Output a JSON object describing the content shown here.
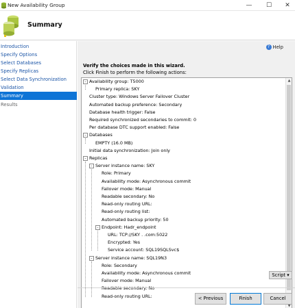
{
  "window": {
    "title": "New Availability Group",
    "minimize": "—",
    "maximize": "☐",
    "close": "✕"
  },
  "header": {
    "title": "Summary"
  },
  "sidebar": {
    "items": [
      {
        "label": "Introduction",
        "state": "link"
      },
      {
        "label": "Specify Options",
        "state": "link"
      },
      {
        "label": "Select Databases",
        "state": "link"
      },
      {
        "label": "Specify Replicas",
        "state": "link"
      },
      {
        "label": "Select Data Synchronization",
        "state": "link"
      },
      {
        "label": "Validation",
        "state": "link"
      },
      {
        "label": "Summary",
        "state": "selected"
      },
      {
        "label": "Results",
        "state": "disabled"
      }
    ]
  },
  "main": {
    "help_label": "Help",
    "verify_text": "Verify the choices made in this wizard.",
    "instruction": "Click Finish to perform the following actions:",
    "tree": [
      {
        "level": 0,
        "toggle": "-",
        "text": "Availability group: T5000"
      },
      {
        "level": 1,
        "text": "Primary replica: SKY"
      },
      {
        "level": 0,
        "text": "Cluster type: Windows Server Failover Cluster"
      },
      {
        "level": 0,
        "text": "Automated backup preference: Secondary"
      },
      {
        "level": 0,
        "text": "Database health trigger: False"
      },
      {
        "level": 0,
        "text": "Required synchronized secondaries to commit: 0"
      },
      {
        "level": 0,
        "text": "Per database DTC support enabled: False"
      },
      {
        "level": 0,
        "toggle": "-",
        "text": "Databases"
      },
      {
        "level": 1,
        "text": "EMPTY (16.0 MB)"
      },
      {
        "level": 0,
        "text": "Initial data synchronization: Join only"
      },
      {
        "level": 0,
        "toggle": "-",
        "text": "Replicas"
      },
      {
        "level": 1,
        "toggle": "-",
        "text": "Server instance name: SKY"
      },
      {
        "level": 2,
        "text": "Role: Primary"
      },
      {
        "level": 2,
        "text": "Availability mode: Asynchronous commit"
      },
      {
        "level": 2,
        "text": "Failover mode: Manual"
      },
      {
        "level": 2,
        "text": "Readable secondary: No"
      },
      {
        "level": 2,
        "text": "Read-only routing URL:"
      },
      {
        "level": 2,
        "text": "Read-only routing list:"
      },
      {
        "level": 2,
        "text": "Automated backup priority: 50"
      },
      {
        "level": 2,
        "toggle": "-",
        "text": "Endpoint: Hadr_endpoint"
      },
      {
        "level": 3,
        "text": "URL: TCP://SKY        .       .com:5022"
      },
      {
        "level": 3,
        "text": "Encrypted: Yes"
      },
      {
        "level": 3,
        "text": "Service account:               SQL19SQLSvc$"
      },
      {
        "level": 1,
        "toggle": "-",
        "text": "Server instance name: SQL19N3"
      },
      {
        "level": 2,
        "text": "Role: Secondary"
      },
      {
        "level": 2,
        "text": "Availability mode: Asynchronous commit"
      },
      {
        "level": 2,
        "text": "Failover mode: Manual"
      },
      {
        "level": 2,
        "text": "Readable secondary: No"
      },
      {
        "level": 2,
        "text": "Read-only routing URL:"
      }
    ],
    "script_button": "Script",
    "script_arrow": "▾",
    "scroll_up_arrow": "▲",
    "scroll_down_arrow": "▼"
  },
  "buttons": {
    "previous": "< Previous",
    "finish": "Finish",
    "cancel": "Cancel"
  },
  "colors": {
    "link": "#1a54a6",
    "selected_bg": "#0e74d6",
    "panel_bg": "#f0f0f0"
  }
}
